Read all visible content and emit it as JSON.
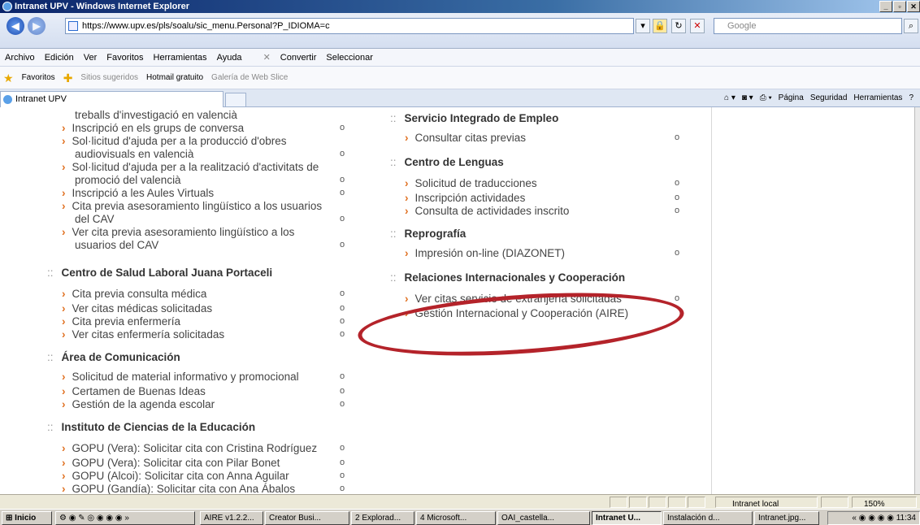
{
  "window": {
    "title": "Intranet UPV - Windows Internet Explorer"
  },
  "address": {
    "url": "https://www.upv.es/pls/soalu/sic_menu.Personal?P_IDIOMA=c",
    "search_placeholder": "Google"
  },
  "menubar": [
    "Archivo",
    "Edición",
    "Ver",
    "Favoritos",
    "Herramientas",
    "Ayuda",
    "Convertir",
    "Seleccionar"
  ],
  "favbar": [
    "Favoritos",
    "Sitios sugeridos",
    "Hotmail gratuito",
    "Galería de Web Slice"
  ],
  "tab": {
    "label": "Intranet UPV"
  },
  "cmdbar": [
    "Página",
    "Seguridad",
    "Herramientas"
  ],
  "left": {
    "top_items": [
      "treballs d'investigació en valencià",
      "Inscripció en els grups de conversa",
      "Sol·licitud d'ajuda per a la producció d'obres",
      "audiovisuals en valencià",
      "Sol·licitud d'ajuda per a la realització d'activitats de",
      "promoció del valencià",
      "Inscripció a les Aules Virtuals",
      "Cita previa asesoramiento lingüístico a los usuarios",
      "del CAV",
      "Ver cita previa asesoramiento lingüístico a los",
      "usuarios del CAV"
    ],
    "salud_title": "Centro de Salud Laboral Juana Portaceli",
    "salud_items": [
      "Cita previa consulta médica",
      "Ver citas médicas solicitadas",
      "Cita previa enfermería",
      "Ver citas enfermería solicitadas"
    ],
    "comunicacion_title": "Área de Comunicación",
    "comunicacion_items": [
      "Solicitud de material informativo y promocional",
      "Certamen de Buenas Ideas",
      "Gestión de la agenda escolar"
    ],
    "ice_title": "Instituto de Ciencias de la Educación",
    "ice_items": [
      "GOPU (Vera): Solicitar cita con Cristina Rodríguez",
      "GOPU (Vera): Solicitar cita con Pilar Bonet",
      "GOPU (Alcoi): Solicitar cita con Anna Aguilar",
      "GOPU (Gandía): Solicitar cita con Ana Ábalos"
    ]
  },
  "right": {
    "empleo_title": "Servicio Integrado de Empleo",
    "empleo_items": [
      "Consultar citas previas"
    ],
    "lenguas_title": "Centro de Lenguas",
    "lenguas_items": [
      "Solicitud de traducciones",
      "Inscripción actividades",
      "Consulta de actividades inscrito"
    ],
    "repro_title": "Reprografía",
    "repro_items": [
      "Impresión on-line (DIAZONET)"
    ],
    "ri_title": "Relaciones Internacionales y Cooperación",
    "ri_items": [
      "Ver citas servicio de extranjería solicitadas",
      "Gestión Internacional y Cooperación (AIRE)"
    ]
  },
  "status": {
    "zone": "Intranet local",
    "zoom": "150%"
  },
  "taskbar": {
    "start": "Inicio",
    "items": [
      "AIRE v1.2.2...",
      "Creator Busi...",
      "2 Explorad...",
      "4 Microsoft...",
      "OAI_castella...",
      "Intranet U...",
      "Instalación d...",
      "Intranet.jpg..."
    ],
    "clock": "11:34"
  }
}
